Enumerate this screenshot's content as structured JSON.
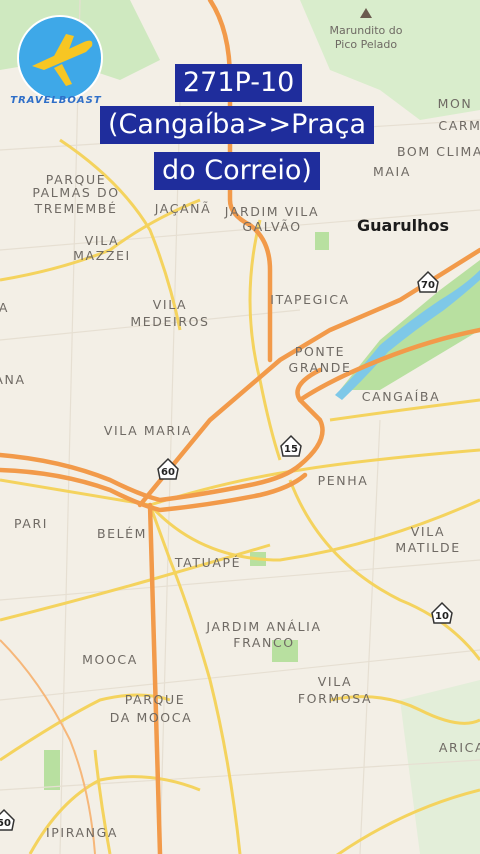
{
  "title": {
    "line1": "271P-10",
    "line2": "(Cangaíba>>Praça",
    "line3": "do Correio)"
  },
  "logo": {
    "text": "TRAVELBOAST",
    "icon": "airplane-icon"
  },
  "peak": {
    "label1": "Marundito do",
    "label2": "Pico Pelado"
  },
  "city": "Guarulhos",
  "areas": {
    "palmas1": "PARQUE",
    "palmas2": "PALMAS DO",
    "palmas3": "TREMEMBÉ",
    "jacana": "JAÇANÃ",
    "galvao1": "JARDIM VILA",
    "galvao2": "GALVÃO",
    "mazzei1": "VILA",
    "mazzei2": "MAZZEI",
    "medeiros1": "VILA",
    "medeiros2": "MEDEIROS",
    "itapegica": "ITAPEGICA",
    "ponte1": "PONTE",
    "ponte2": "GRANDE",
    "cangaiba": "CANGAÍBA",
    "vila_maria": "VILA MARIA",
    "penha": "PENHA",
    "pari": "PARI",
    "belem": "BELÉM",
    "tatuape": "TATUAPÉ",
    "matilde1": "VILA",
    "matilde2": "MATILDE",
    "analia1": "JARDIM ANÁLIA",
    "analia2": "FRANCO",
    "mooca": "MOOCA",
    "pmooca1": "PARQUE",
    "pmooca2": "DA MOOCA",
    "formosa1": "VILA",
    "formosa2": "FORMOSA",
    "ipiranga": "IPIRANGA",
    "maia": "MAIA",
    "bom_clima": "BOM CLIMA",
    "carm1": "MON",
    "carm2": "CARM",
    "arica": "ARICA",
    "left1": "A",
    "left2": "ANA"
  },
  "shields": {
    "s70": "70",
    "s15": "15",
    "s60": "60",
    "s10": "10",
    "s50": "50"
  },
  "colors": {
    "highway": "#f29a4a",
    "arterial": "#f4d35e",
    "park": "#b8e0a0",
    "water": "#7ec8e8",
    "title_bg": "#1f2d9c"
  }
}
